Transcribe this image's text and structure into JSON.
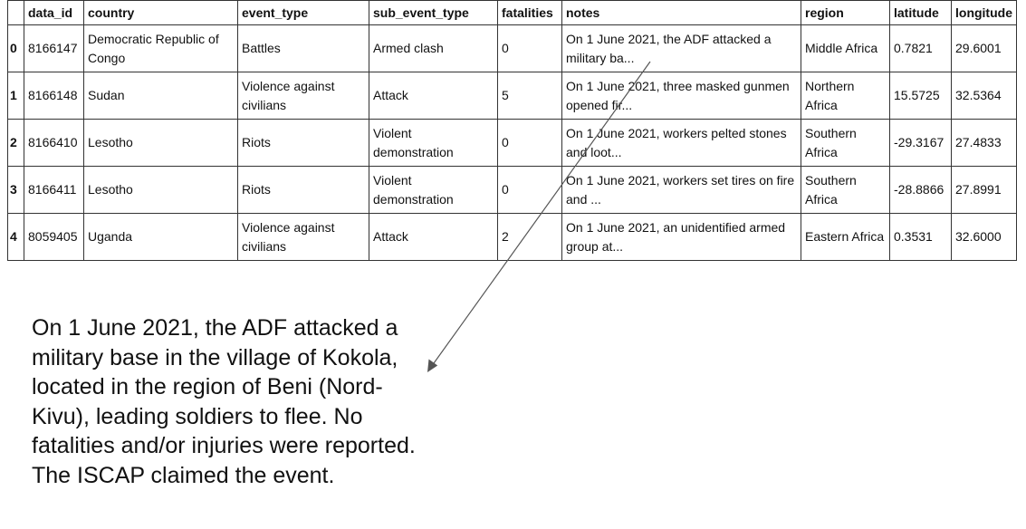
{
  "table": {
    "columns": [
      "data_id",
      "country",
      "event_type",
      "sub_event_type",
      "fatalities",
      "notes",
      "region",
      "latitude",
      "longitude"
    ],
    "rows": [
      {
        "index": "0",
        "data_id": "8166147",
        "country": "Democratic Republic of Congo",
        "event_type": "Battles",
        "sub_event_type": "Armed clash",
        "fatalities": "0",
        "notes": "On 1 June 2021, the ADF attacked a military ba...",
        "region": "Middle Africa",
        "latitude": "0.7821",
        "longitude": "29.6001"
      },
      {
        "index": "1",
        "data_id": "8166148",
        "country": "Sudan",
        "event_type": "Violence against civilians",
        "sub_event_type": "Attack",
        "fatalities": "5",
        "notes": "On 1 June 2021, three masked gunmen opened fir...",
        "region": "Northern Africa",
        "latitude": "15.5725",
        "longitude": "32.5364"
      },
      {
        "index": "2",
        "data_id": "8166410",
        "country": "Lesotho",
        "event_type": "Riots",
        "sub_event_type": "Violent demonstration",
        "fatalities": "0",
        "notes": "On 1 June 2021, workers pelted stones and loot...",
        "region": "Southern Africa",
        "latitude": "-29.3167",
        "longitude": "27.4833"
      },
      {
        "index": "3",
        "data_id": "8166411",
        "country": "Lesotho",
        "event_type": "Riots",
        "sub_event_type": "Violent demonstration",
        "fatalities": "0",
        "notes": "On 1 June 2021, workers set tires on fire and ...",
        "region": "Southern Africa",
        "latitude": "-28.8866",
        "longitude": "27.8991"
      },
      {
        "index": "4",
        "data_id": "8059405",
        "country": "Uganda",
        "event_type": "Violence against civilians",
        "sub_event_type": "Attack",
        "fatalities": "2",
        "notes": "On 1 June 2021, an unidentified armed group at...",
        "region": "Eastern Africa",
        "latitude": "0.3531",
        "longitude": "32.6000"
      }
    ]
  },
  "expanded_note": "On 1 June 2021, the ADF attacked a military base in the village of Kokola, located in the region of Beni (Nord-Kivu), leading soldiers to flee. No fatalities and/or injuries were reported. The ISCAP claimed the event.",
  "colors": {
    "border": "#333333",
    "text": "#111111",
    "arrow": "#555555"
  }
}
